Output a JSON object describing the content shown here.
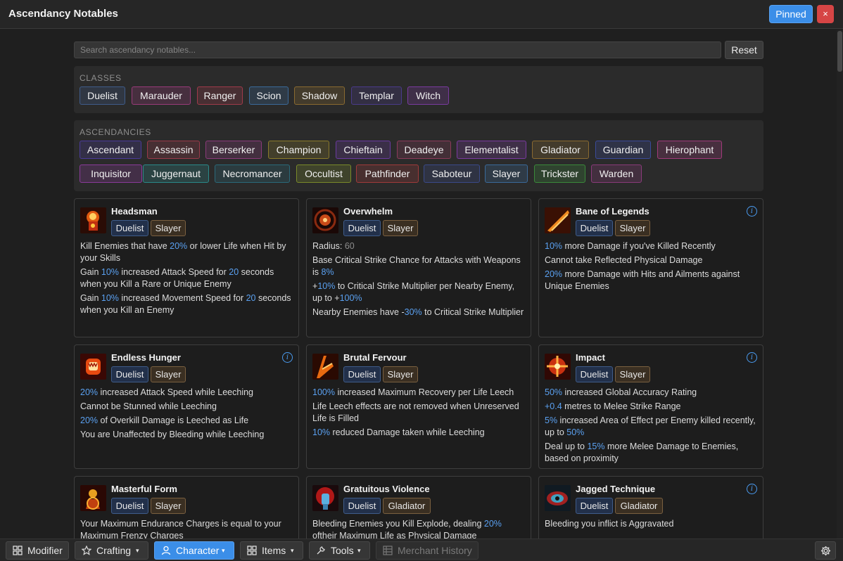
{
  "app": {
    "title": "Ascendancy Notables",
    "pinned_label": "Pinned",
    "close_label": "×"
  },
  "search": {
    "placeholder": "Search ascendancy notables...",
    "value": "",
    "reset_label": "Reset"
  },
  "classes": {
    "label": "CLASSES",
    "items": [
      "Duelist",
      "Marauder",
      "Ranger",
      "Scion",
      "Shadow",
      "Templar",
      "Witch"
    ]
  },
  "ascendancies": {
    "label": "ASCENDANCIES",
    "items": [
      "Ascendant",
      "Assassin",
      "Berserker",
      "Champion",
      "Chieftain",
      "Deadeye",
      "Elementalist",
      "Gladiator",
      "Guardian",
      "Hierophant",
      "Inquisitor",
      "Juggernaut",
      "Necromancer",
      "Occultist",
      "Pathfinder",
      "Saboteur",
      "Slayer",
      "Trickster",
      "Warden"
    ]
  },
  "colors": {
    "accent": "#3b8ee8",
    "number": "#5aa0f0",
    "close": "#d64545",
    "class_borders": [
      "#3f5c8a",
      "#9a3a7a",
      "#a03a4a",
      "#3a6a9a",
      "#8a6a30",
      "#4a3a8a",
      "#7a3aa0"
    ],
    "ascendancy_borders": [
      "#4a3a9a",
      "#9a3a4a",
      "#8a3a7a",
      "#8a7a2a",
      "#6a3aa0",
      "#8a3a5a",
      "#7a3aa0",
      "#8a6a30",
      "#3a4a9a",
      "#a03a7a",
      "#8a3a9a",
      "#2a8a8a",
      "#2a6a7a",
      "#7a8a2a",
      "#a03a3a",
      "#3a4a8a",
      "#3a6a9a",
      "#3a8a3a",
      "#8a3a7a"
    ]
  },
  "cards": [
    {
      "name": "Headsman",
      "tags": [
        "Duelist",
        "Slayer"
      ],
      "info": false,
      "icon": "headsman-icon",
      "lines": [
        [
          [
            "Kill Enemies that have ",
            ""
          ],
          [
            "20%",
            "num"
          ],
          [
            " or lower Life when Hit by your Skills",
            ""
          ]
        ],
        [
          [
            "Gain ",
            ""
          ],
          [
            "10%",
            "num"
          ],
          [
            " increased Attack Speed for ",
            ""
          ],
          [
            "20",
            "num"
          ],
          [
            " seconds when you Kill a Rare or Unique Enemy",
            ""
          ]
        ],
        [
          [
            "Gain ",
            ""
          ],
          [
            "10%",
            "num"
          ],
          [
            " increased Movement Speed for ",
            ""
          ],
          [
            "20",
            "num"
          ],
          [
            " seconds when you Kill an Enemy",
            ""
          ]
        ]
      ]
    },
    {
      "name": "Overwhelm",
      "tags": [
        "Duelist",
        "Slayer"
      ],
      "info": false,
      "icon": "overwhelm-icon",
      "lines": [
        [
          [
            "Radius: ",
            ""
          ],
          [
            "60",
            "dim"
          ]
        ],
        [
          [
            "Base Critical Strike Chance for Attacks with Weapons is ",
            ""
          ],
          [
            "8%",
            "num"
          ]
        ],
        [
          [
            "+",
            ""
          ],
          [
            "10%",
            "num"
          ],
          [
            " to Critical Strike Multiplier per Nearby Enemy, up to +",
            ""
          ],
          [
            "100%",
            "num"
          ]
        ],
        [
          [
            "Nearby Enemies have -",
            ""
          ],
          [
            "30%",
            "num"
          ],
          [
            " to Critical Strike Multiplier",
            ""
          ]
        ]
      ]
    },
    {
      "name": "Bane of Legends",
      "tags": [
        "Duelist",
        "Slayer"
      ],
      "info": true,
      "icon": "bane-of-legends-icon",
      "lines": [
        [
          [
            "10%",
            "num"
          ],
          [
            " more Damage if you've Killed Recently",
            ""
          ]
        ],
        [
          [
            "Cannot take Reflected Physical Damage",
            ""
          ]
        ],
        [
          [
            "20%",
            "num"
          ],
          [
            " more Damage with Hits and Ailments against Unique Enemies",
            ""
          ]
        ]
      ]
    },
    {
      "name": "Endless Hunger",
      "tags": [
        "Duelist",
        "Slayer"
      ],
      "info": true,
      "icon": "endless-hunger-icon",
      "lines": [
        [
          [
            "20%",
            "num"
          ],
          [
            " increased Attack Speed while Leeching",
            ""
          ]
        ],
        [
          [
            "Cannot be Stunned while Leeching",
            ""
          ]
        ],
        [
          [
            "20%",
            "num"
          ],
          [
            " of Overkill Damage is Leeched as Life",
            ""
          ]
        ],
        [
          [
            "You are Unaffected by Bleeding while Leeching",
            ""
          ]
        ]
      ]
    },
    {
      "name": "Brutal Fervour",
      "tags": [
        "Duelist",
        "Slayer"
      ],
      "info": false,
      "icon": "brutal-fervour-icon",
      "lines": [
        [
          [
            "100%",
            "num"
          ],
          [
            " increased Maximum Recovery per Life Leech",
            ""
          ]
        ],
        [
          [
            "Life Leech effects are not removed when Unreserved Life is Filled",
            ""
          ]
        ],
        [
          [
            "10%",
            "num"
          ],
          [
            " reduced Damage taken while Leeching",
            ""
          ]
        ]
      ]
    },
    {
      "name": "Impact",
      "tags": [
        "Duelist",
        "Slayer"
      ],
      "info": true,
      "icon": "impact-icon",
      "lines": [
        [
          [
            "50%",
            "num"
          ],
          [
            " increased Global Accuracy Rating",
            ""
          ]
        ],
        [
          [
            "+0.4",
            "num"
          ],
          [
            " metres to Melee Strike Range",
            ""
          ]
        ],
        [
          [
            "5%",
            "num"
          ],
          [
            " increased Area of Effect per Enemy killed recently, up to ",
            ""
          ],
          [
            "50%",
            "num"
          ]
        ],
        [
          [
            "Deal up to ",
            ""
          ],
          [
            "15%",
            "num"
          ],
          [
            " more Melee Damage to Enemies, based on proximity",
            ""
          ]
        ]
      ]
    },
    {
      "name": "Masterful Form",
      "tags": [
        "Duelist",
        "Slayer"
      ],
      "info": false,
      "icon": "masterful-form-icon",
      "lines": [
        [
          [
            "Your Maximum Endurance Charges is equal to your Maximum Frenzy Charges",
            ""
          ]
        ]
      ]
    },
    {
      "name": "Gratuitous Violence",
      "tags": [
        "Duelist",
        "Gladiator"
      ],
      "info": false,
      "icon": "gratuitous-violence-icon",
      "lines": [
        [
          [
            "Bleeding Enemies you Kill Explode, dealing ",
            ""
          ],
          [
            "20%",
            "num"
          ],
          [
            " oftheir Maximum Life as Physical Damage",
            ""
          ]
        ]
      ]
    },
    {
      "name": "Jagged Technique",
      "tags": [
        "Duelist",
        "Gladiator"
      ],
      "info": true,
      "icon": "jagged-technique-icon",
      "lines": [
        [
          [
            "Bleeding you inflict is Aggravated",
            ""
          ]
        ]
      ]
    }
  ],
  "bottom_nav": {
    "modifier": "Modifier",
    "crafting": "Crafting",
    "character": "Character",
    "items": "Items",
    "tools": "Tools",
    "merchant_history": "Merchant History",
    "caret": "▾"
  }
}
